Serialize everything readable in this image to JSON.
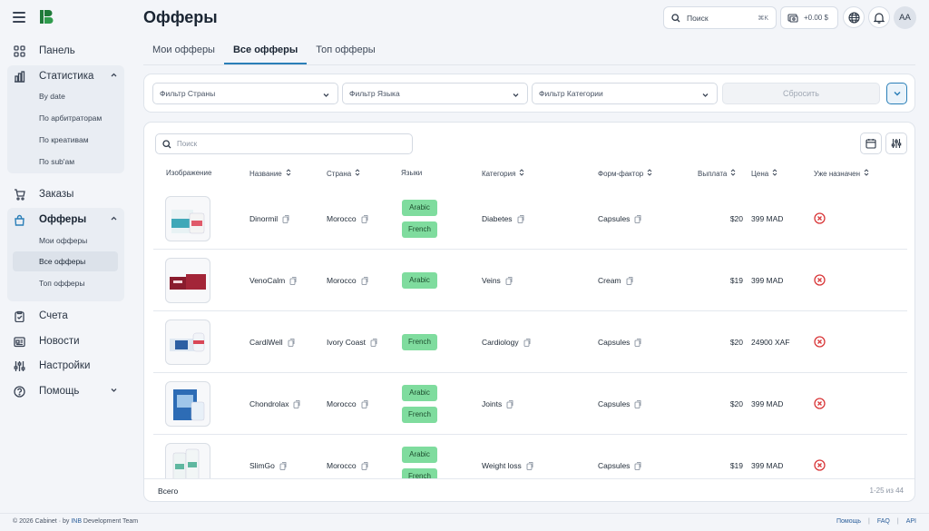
{
  "app": {
    "logo_alt": "IB"
  },
  "sidebar": {
    "items": [
      {
        "label": "Панель",
        "icon": "grid-icon"
      },
      {
        "label": "Статистика",
        "icon": "chart-bar-icon"
      },
      {
        "label": "Заказы",
        "icon": "cart-icon"
      },
      {
        "label": "Офферы",
        "icon": "bag-icon"
      },
      {
        "label": "Счета",
        "icon": "clipboard-check-icon"
      },
      {
        "label": "Новости",
        "icon": "newspaper-icon"
      },
      {
        "label": "Настройки",
        "icon": "sliders-icon"
      },
      {
        "label": "Помощь",
        "icon": "help-circle-icon"
      }
    ],
    "stats_sub": [
      "By date",
      "По арбитраторам",
      "По креативам",
      "По sub'ам"
    ],
    "offers_sub": [
      "Мои офферы",
      "Все офферы",
      "Топ офферы"
    ]
  },
  "header": {
    "title": "Офферы",
    "search_label": "Поиск",
    "search_shortcut": "⌘K",
    "balance": "+0.00 $",
    "avatar": "AA"
  },
  "tabs": [
    "Мои офферы",
    "Все офферы",
    "Топ офферы"
  ],
  "filters": {
    "country": "Фильтр Страны",
    "language": "Фильтр Языка",
    "category": "Фильтр Категории",
    "reset": "Сбросить"
  },
  "table": {
    "search_placeholder": "Поиск",
    "columns": [
      "Изображение",
      "Название",
      "Страна",
      "Языки",
      "Категория",
      "Форм-фактор",
      "Выплата",
      "Цена",
      "Уже назначен"
    ],
    "rows": [
      {
        "name": "Dinormil",
        "country": "Morocco",
        "languages": [
          "Arabic",
          "French"
        ],
        "category": "Diabetes",
        "form": "Capsules",
        "payout": "$20",
        "price": "399 MAD"
      },
      {
        "name": "VenoCalm",
        "country": "Morocco",
        "languages": [
          "Arabic"
        ],
        "category": "Veins",
        "form": "Cream",
        "payout": "$19",
        "price": "399 MAD"
      },
      {
        "name": "CardiWell",
        "country": "Ivory Coast",
        "languages": [
          "French"
        ],
        "category": "Cardiology",
        "form": "Capsules",
        "payout": "$20",
        "price": "24900 XAF"
      },
      {
        "name": "Chondrolax",
        "country": "Morocco",
        "languages": [
          "Arabic",
          "French"
        ],
        "category": "Joints",
        "form": "Capsules",
        "payout": "$20",
        "price": "399 MAD"
      },
      {
        "name": "SlimGo",
        "country": "Morocco",
        "languages": [
          "Arabic",
          "French"
        ],
        "category": "Weight loss",
        "form": "Capsules",
        "payout": "$19",
        "price": "399 MAD"
      }
    ],
    "footer_label": "Всего",
    "pagination": "1-25 из 44"
  },
  "footer": {
    "copyright_prefix": "© 2026 Cabinet · by ",
    "brand": "INB",
    "copyright_suffix": " Development Team",
    "links": [
      "Помощь",
      "FAQ",
      "API"
    ],
    "separator": "|"
  },
  "colors": {
    "accent": "#2a7fb8",
    "lang_badge": "#7fdc9e",
    "danger": "#d9383a"
  }
}
